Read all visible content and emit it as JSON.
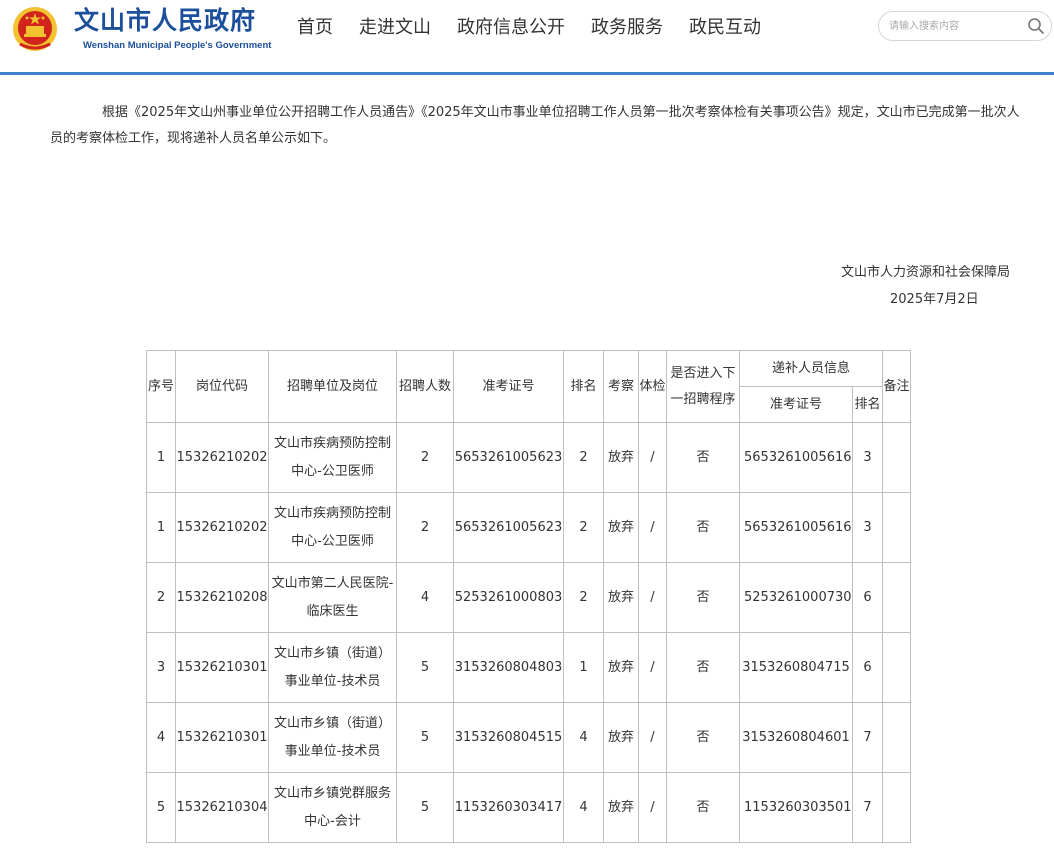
{
  "header": {
    "site_title": "文山市人民政府",
    "site_subtitle": "Wenshan Municipal People's Government",
    "nav": [
      "首页",
      "走进文山",
      "政府信息公开",
      "政务服务",
      "政民互动"
    ],
    "search_placeholder": "请输入搜索内容"
  },
  "article": {
    "intro": "根据《2025年文山州事业单位公开招聘工作人员通告》《2025年文山市事业单位招聘工作人员第一批次考察体检有关事项公告》规定，文山市已完成第一批次人员的考察体检工作，现将递补人员名单公示如下。",
    "signature_org": "文山市人力资源和社会保障局",
    "signature_date": "2025年7月2日"
  },
  "table": {
    "headers": {
      "seq": "序号",
      "post_code": "岗位代码",
      "unit": "招聘单位及岗位",
      "quota": "招聘人数",
      "ticket": "准考证号",
      "rank": "排名",
      "inspection": "考察",
      "physical": "体检",
      "next_stage": "是否进入下一招聘程序",
      "sub_info": "递补人员信息",
      "sub_ticket": "准考证号",
      "sub_rank": "排名",
      "remark": "备注"
    },
    "rows": [
      {
        "seq": "1",
        "post_code": "15326210202",
        "unit": "文山市疾病预防控制中心-公卫医师",
        "quota": "2",
        "ticket": "5653261005623",
        "rank": "2",
        "inspection": "放弃",
        "physical": "/",
        "next": "否",
        "sub_ticket": "5653261005616",
        "sub_rank": "3",
        "remark": ""
      },
      {
        "seq": "1",
        "post_code": "15326210202",
        "unit": "文山市疾病预防控制中心-公卫医师",
        "quota": "2",
        "ticket": "5653261005623",
        "rank": "2",
        "inspection": "放弃",
        "physical": "/",
        "next": "否",
        "sub_ticket": "5653261005616",
        "sub_rank": "3",
        "remark": ""
      },
      {
        "seq": "2",
        "post_code": "15326210208",
        "unit": "文山市第二人民医院-临床医生",
        "quota": "4",
        "ticket": "5253261000803",
        "rank": "2",
        "inspection": "放弃",
        "physical": "/",
        "next": "否",
        "sub_ticket": "5253261000730",
        "sub_rank": "6",
        "remark": ""
      },
      {
        "seq": "3",
        "post_code": "15326210301",
        "unit": "文山市乡镇（街道）事业单位-技术员",
        "quota": "5",
        "ticket": "3153260804803",
        "rank": "1",
        "inspection": "放弃",
        "physical": "/",
        "next": "否",
        "sub_ticket": "3153260804715",
        "sub_rank": "6",
        "remark": ""
      },
      {
        "seq": "4",
        "post_code": "15326210301",
        "unit": "文山市乡镇（街道）事业单位-技术员",
        "quota": "5",
        "ticket": "3153260804515",
        "rank": "4",
        "inspection": "放弃",
        "physical": "/",
        "next": "否",
        "sub_ticket": "3153260804601",
        "sub_rank": "7",
        "remark": ""
      },
      {
        "seq": "5",
        "post_code": "15326210304",
        "unit": "文山市乡镇党群服务中心-会计",
        "quota": "5",
        "ticket": "1153260303417",
        "rank": "4",
        "inspection": "放弃",
        "physical": "/",
        "next": "否",
        "sub_ticket": "1153260303501",
        "sub_rank": "7",
        "remark": ""
      }
    ]
  },
  "colors": {
    "brand": "#1b4e9b",
    "header_line": "#3f7fcf",
    "emblem_red": "#d2231c",
    "emblem_gold": "#f2c230",
    "table_border": "#bfbfbf"
  }
}
